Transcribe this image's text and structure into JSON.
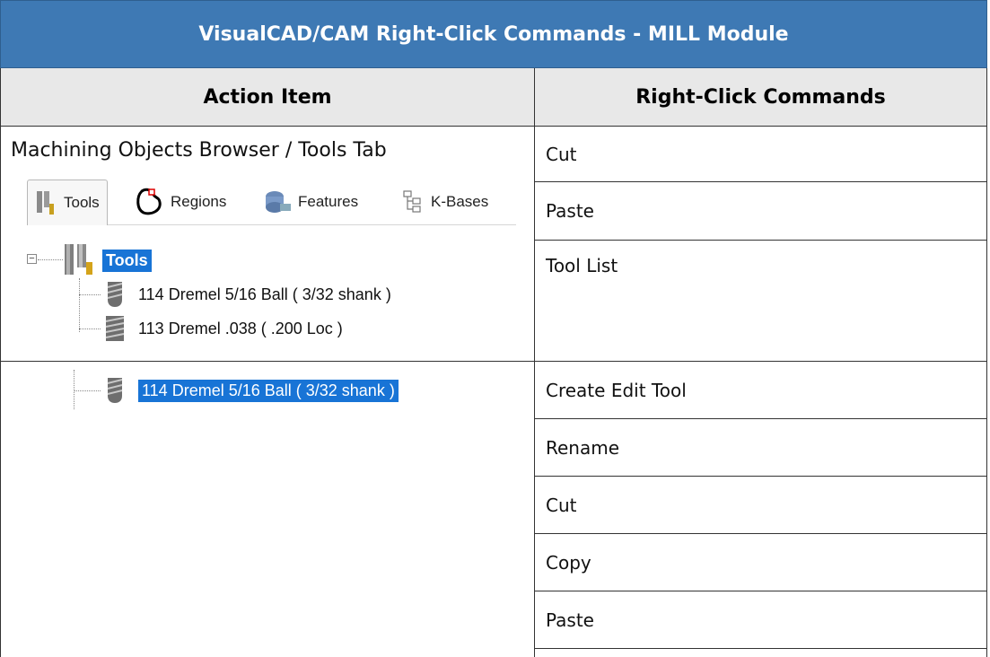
{
  "table": {
    "title": "VisualCAD/CAM Right-Click Commands - MILL Module",
    "col_left": "Action Item",
    "col_right": "Right-Click Commands"
  },
  "row1": {
    "label": "Machining Objects Browser / Tools Tab",
    "tabs": [
      "Tools",
      "Regions",
      "Features",
      "K-Bases"
    ],
    "tree_root": "Tools",
    "tree_items": [
      "114 Dremel 5/16 Ball  ( 3/32 shank )",
      "113 Dremel .038 ( .200 Loc )"
    ],
    "commands": [
      "Cut",
      "Paste",
      "Tool List"
    ]
  },
  "row2": {
    "selected_item": "114 Dremel 5/16 Ball  ( 3/32 shank )",
    "commands": [
      "Create Edit Tool",
      "Rename",
      "Cut",
      "Copy",
      "Paste"
    ]
  }
}
